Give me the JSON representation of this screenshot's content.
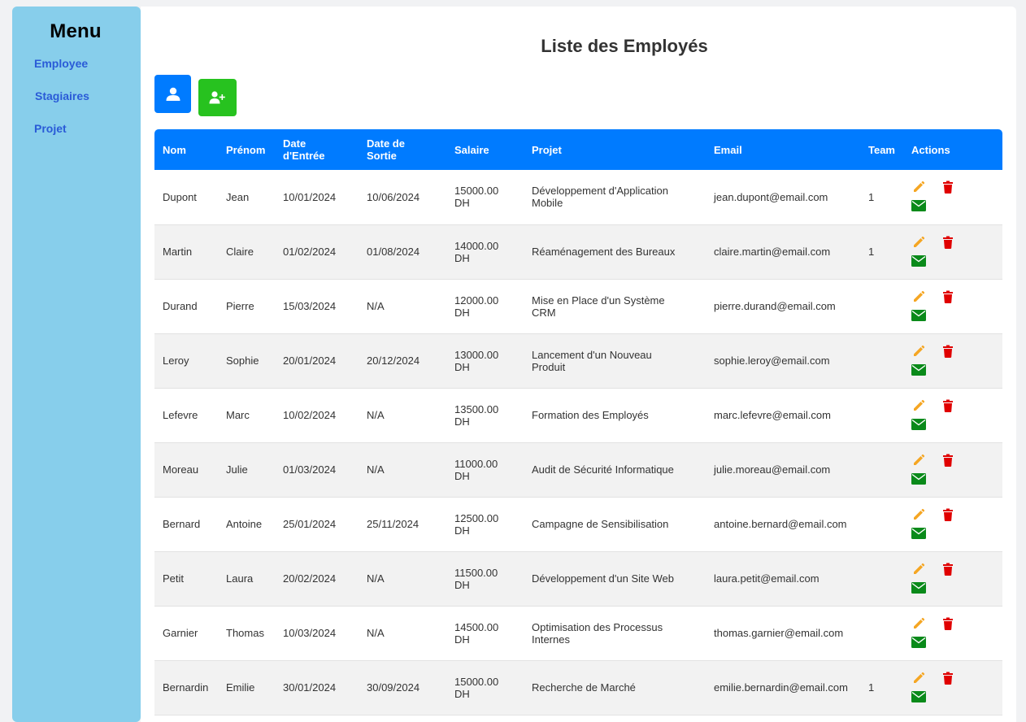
{
  "sidebar": {
    "title": "Menu",
    "items": [
      {
        "label": "Employee"
      },
      {
        "label": "Stagiaires"
      },
      {
        "label": "Projet"
      }
    ]
  },
  "main": {
    "title": "Liste des Employés"
  },
  "colors": {
    "sidebar_bg": "#87ceeb",
    "primary": "#007bff",
    "add_button": "#27c21f",
    "edit_icon": "#f5a623",
    "delete_icon": "#e00000",
    "mail_icon": "#0a8a1a"
  },
  "icons": {
    "user_button": "user-icon",
    "add_button": "add-user-icon",
    "edit": "pencil-icon",
    "delete": "trash-icon",
    "mail": "envelope-icon"
  },
  "table": {
    "headers": {
      "nom": "Nom",
      "prenom": "Prénom",
      "date_entree": "Date d'Entrée",
      "date_sortie": "Date de Sortie",
      "salaire": "Salaire",
      "projet": "Projet",
      "email": "Email",
      "team": "Team",
      "actions": "Actions"
    },
    "rows": [
      {
        "nom": "Dupont",
        "prenom": "Jean",
        "date_entree": "10/01/2024",
        "date_sortie": "10/06/2024",
        "salaire": "15000.00 DH",
        "projet": "Développement d'Application Mobile",
        "email": "jean.dupont@email.com",
        "team": "1"
      },
      {
        "nom": "Martin",
        "prenom": "Claire",
        "date_entree": "01/02/2024",
        "date_sortie": "01/08/2024",
        "salaire": "14000.00 DH",
        "projet": "Réaménagement des Bureaux",
        "email": "claire.martin@email.com",
        "team": "1"
      },
      {
        "nom": "Durand",
        "prenom": "Pierre",
        "date_entree": "15/03/2024",
        "date_sortie": "N/A",
        "salaire": "12000.00 DH",
        "projet": "Mise en Place d'un Système CRM",
        "email": "pierre.durand@email.com",
        "team": ""
      },
      {
        "nom": "Leroy",
        "prenom": "Sophie",
        "date_entree": "20/01/2024",
        "date_sortie": "20/12/2024",
        "salaire": "13000.00 DH",
        "projet": "Lancement d'un Nouveau Produit",
        "email": "sophie.leroy@email.com",
        "team": ""
      },
      {
        "nom": "Lefevre",
        "prenom": "Marc",
        "date_entree": "10/02/2024",
        "date_sortie": "N/A",
        "salaire": "13500.00 DH",
        "projet": "Formation des Employés",
        "email": "marc.lefevre@email.com",
        "team": ""
      },
      {
        "nom": "Moreau",
        "prenom": "Julie",
        "date_entree": "01/03/2024",
        "date_sortie": "N/A",
        "salaire": "11000.00 DH",
        "projet": "Audit de Sécurité Informatique",
        "email": "julie.moreau@email.com",
        "team": ""
      },
      {
        "nom": "Bernard",
        "prenom": "Antoine",
        "date_entree": "25/01/2024",
        "date_sortie": "25/11/2024",
        "salaire": "12500.00 DH",
        "projet": "Campagne de Sensibilisation",
        "email": "antoine.bernard@email.com",
        "team": ""
      },
      {
        "nom": "Petit",
        "prenom": "Laura",
        "date_entree": "20/02/2024",
        "date_sortie": "N/A",
        "salaire": "11500.00 DH",
        "projet": "Développement d'un Site Web",
        "email": "laura.petit@email.com",
        "team": ""
      },
      {
        "nom": "Garnier",
        "prenom": "Thomas",
        "date_entree": "10/03/2024",
        "date_sortie": "N/A",
        "salaire": "14500.00 DH",
        "projet": "Optimisation des Processus Internes",
        "email": "thomas.garnier@email.com",
        "team": ""
      },
      {
        "nom": "Bernardin",
        "prenom": "Emilie",
        "date_entree": "30/01/2024",
        "date_sortie": "30/09/2024",
        "salaire": "15000.00 DH",
        "projet": "Recherche de Marché",
        "email": "emilie.bernardin@email.com",
        "team": "1"
      }
    ]
  }
}
